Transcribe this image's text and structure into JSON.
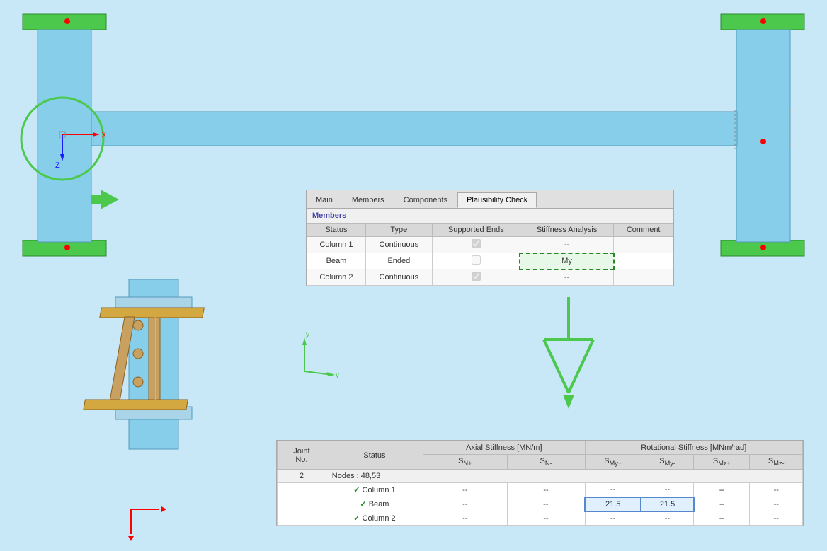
{
  "background_color": "#c8e8f8",
  "tabs": {
    "items": [
      {
        "label": "Main",
        "active": false
      },
      {
        "label": "Members",
        "active": false
      },
      {
        "label": "Components",
        "active": false
      },
      {
        "label": "Plausibility Check",
        "active": true
      }
    ]
  },
  "top_table": {
    "section_title": "Members",
    "columns": [
      "Status",
      "Type",
      "Supported Ends",
      "Stiffness Analysis",
      "Comment"
    ],
    "rows": [
      {
        "status": "Column 1",
        "type": "Continuous",
        "supported_ends": true,
        "stiffness": "--",
        "comment": ""
      },
      {
        "status": "Beam",
        "type": "Ended",
        "supported_ends": false,
        "stiffness": "My",
        "comment": ""
      },
      {
        "status": "Column 2",
        "type": "Continuous",
        "supported_ends": true,
        "stiffness": "--",
        "comment": ""
      }
    ]
  },
  "bottom_table": {
    "columns_header1": [
      "Joint No.",
      "Status",
      "Axial Stiffness [MN/m]",
      "",
      "Rotational Stiffness [MNm/rad]",
      "",
      "",
      ""
    ],
    "columns_header2": [
      "",
      "",
      "SN+",
      "SN-",
      "SMy+",
      "SMy-",
      "SMz+",
      "SMz-"
    ],
    "rows": [
      {
        "joint": "2",
        "label": "Nodes : 48,53",
        "type": "nodes"
      },
      {
        "joint": "",
        "icon": "check",
        "status": "Column 1",
        "sn_plus": "--",
        "sn_minus": "--",
        "smy_plus": "--",
        "smy_minus": "--",
        "smz_plus": "--",
        "smz_minus": "--"
      },
      {
        "joint": "",
        "icon": "check",
        "status": "Beam",
        "sn_plus": "--",
        "sn_minus": "--",
        "smy_plus": "21.5",
        "smy_minus": "21.5",
        "smz_plus": "--",
        "smz_minus": "--"
      },
      {
        "joint": "",
        "icon": "check",
        "status": "Column 2",
        "sn_plus": "--",
        "sn_minus": "--",
        "smy_plus": "--",
        "smy_minus": "--",
        "smz_plus": "--",
        "smz_minus": "--"
      }
    ]
  },
  "axis": {
    "x_label": "X",
    "z_label": "Z",
    "y_label": "y",
    "y2_label": "y"
  }
}
